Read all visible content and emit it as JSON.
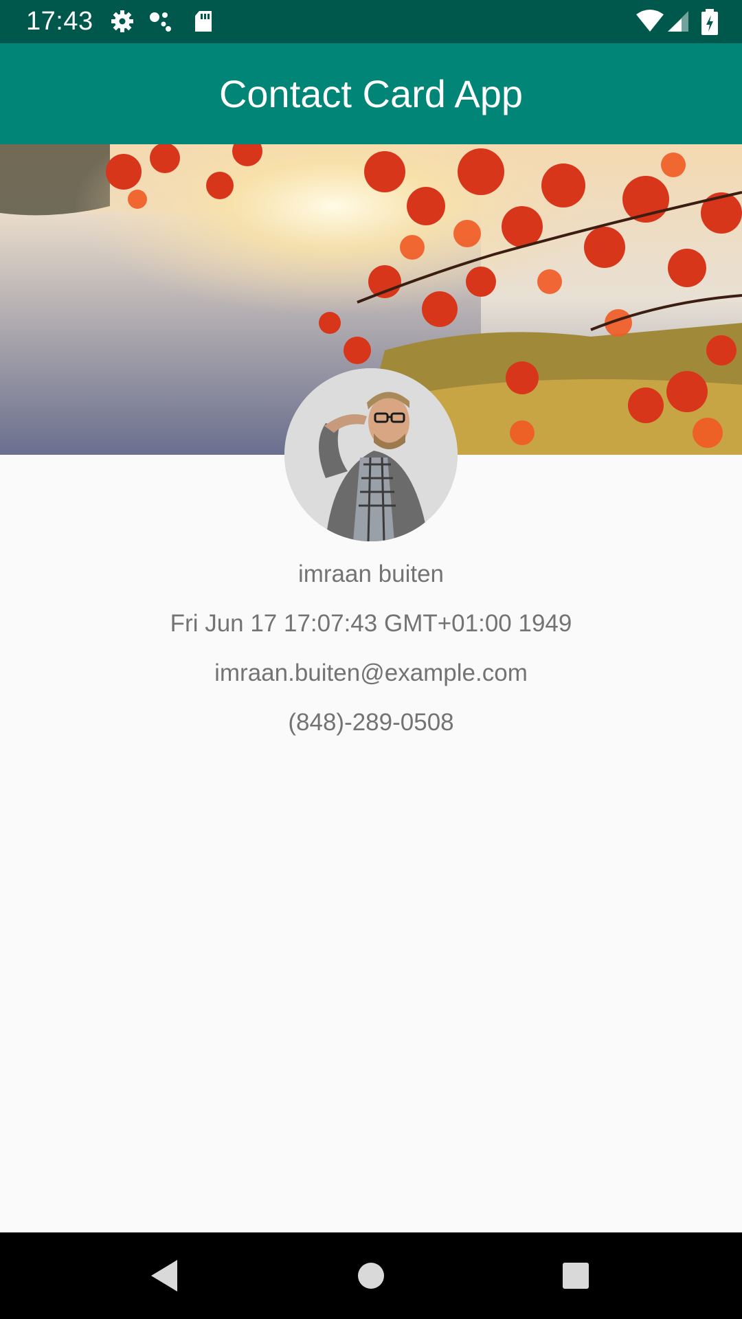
{
  "status_bar": {
    "time": "17:43",
    "icons_left": [
      "settings-gear-icon",
      "network-dots-icon",
      "sd-card-icon"
    ],
    "icons_right": [
      "wifi-icon",
      "cellular-signal-icon",
      "battery-charging-icon"
    ],
    "color": "#00574b"
  },
  "app_bar": {
    "title": "Contact Card App",
    "color": "#008577"
  },
  "banner": {
    "image": "autumn-lake-sunrise-photo"
  },
  "profile": {
    "avatar": "profile-photo-man-glasses",
    "name": "imraan buiten",
    "date_of_birth": "Fri Jun 17 17:07:43 GMT+01:00 1949",
    "email": "imraan.buiten@example.com",
    "phone": "(848)-289-0508",
    "text_color": "#737373"
  },
  "nav_bar": {
    "buttons": [
      "back-icon",
      "home-icon",
      "recents-icon"
    ]
  }
}
